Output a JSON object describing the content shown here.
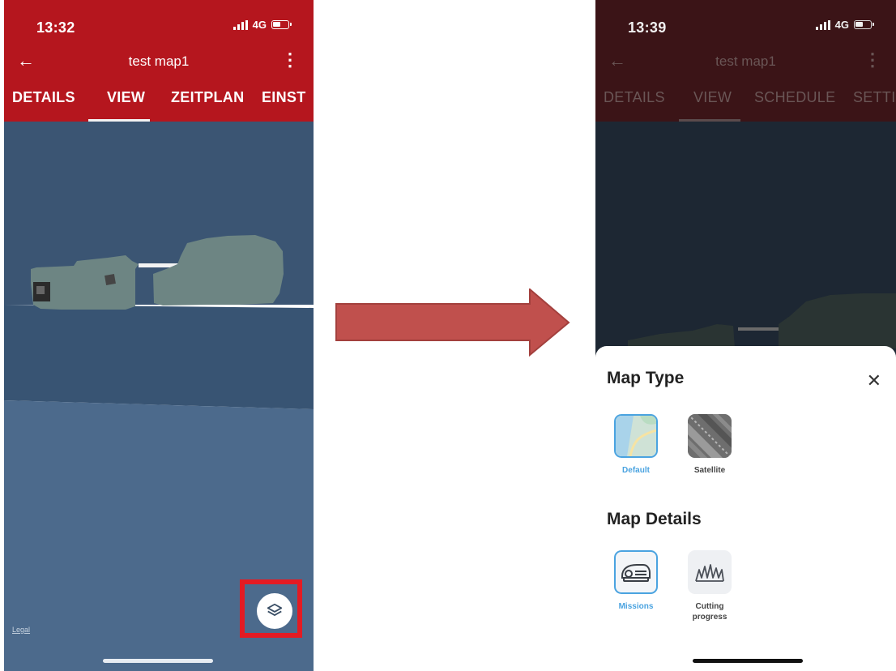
{
  "left": {
    "status": {
      "time": "13:32",
      "network": "4G"
    },
    "title": "test map1",
    "tabs": [
      "DETAILS",
      "VIEW",
      "ZEITPLAN",
      "EINST"
    ],
    "active_tab": "VIEW",
    "legal": "Legal",
    "layers_icon": "layers-icon"
  },
  "right": {
    "status": {
      "time": "13:39",
      "network": "4G"
    },
    "title": "test map1",
    "tabs": [
      "DETAILS",
      "VIEW",
      "SCHEDULE",
      "SETTI"
    ],
    "active_tab": "VIEW",
    "sheet": {
      "map_type_heading": "Map Type",
      "map_type_options": [
        {
          "label": "Default",
          "icon": "default-map-icon",
          "selected": true
        },
        {
          "label": "Satellite",
          "icon": "satellite-map-icon",
          "selected": false
        }
      ],
      "map_details_heading": "Map Details",
      "map_details_options": [
        {
          "label": "Missions",
          "icon": "mower-icon",
          "selected": true
        },
        {
          "label": "Cutting progress",
          "icon": "grass-icon",
          "selected": false
        }
      ]
    }
  },
  "colors": {
    "header_red": "#b5161e",
    "highlight_red": "#e31b23",
    "arrow_red": "#c0504d",
    "selected_blue": "#4aa3e0"
  }
}
